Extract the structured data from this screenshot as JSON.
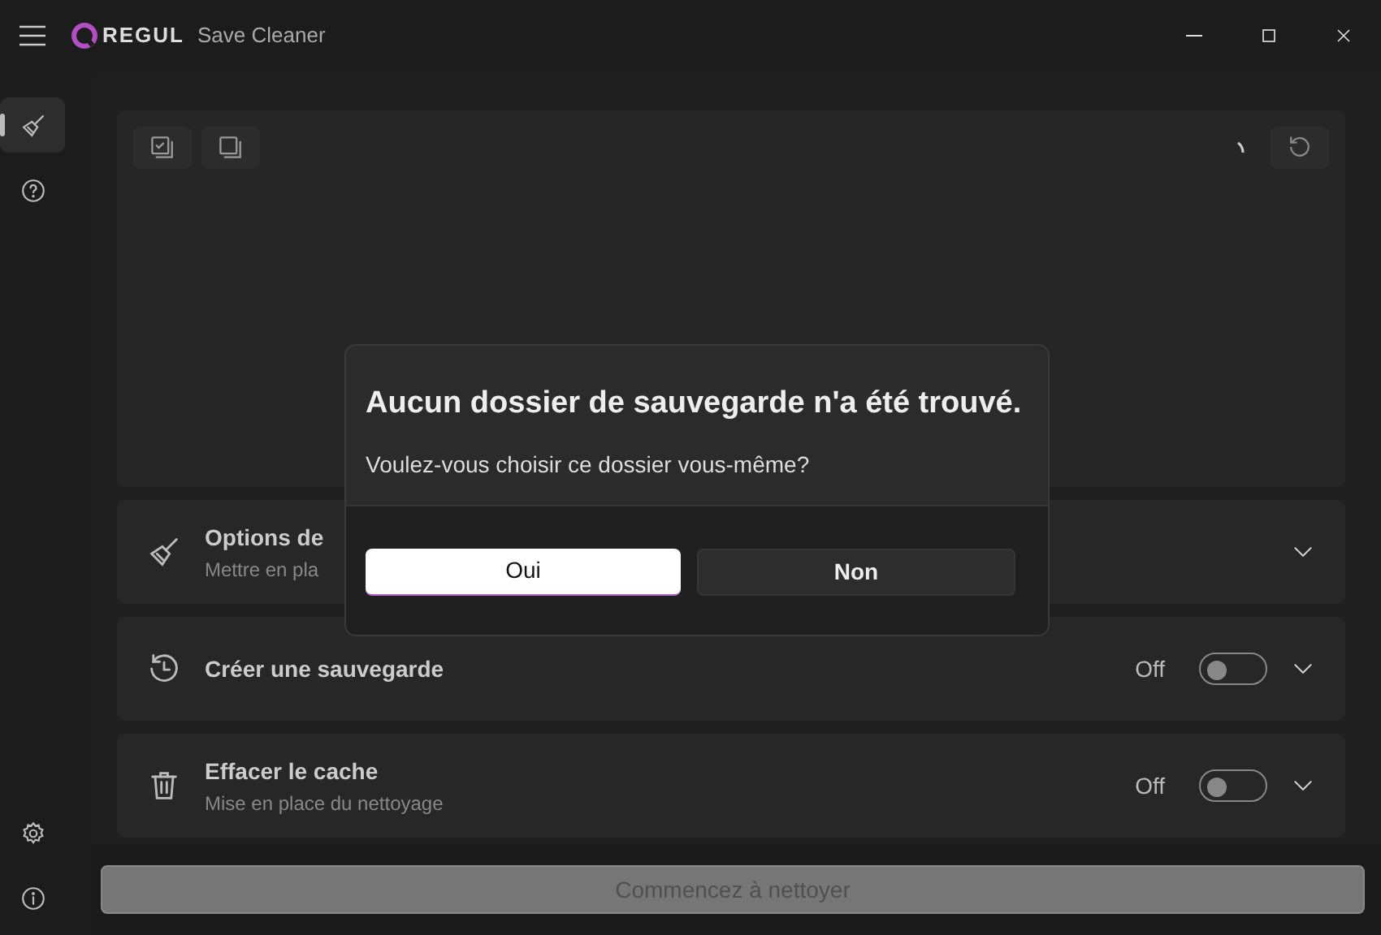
{
  "window": {
    "logo": "REGUL",
    "title": "Save Cleaner"
  },
  "sidebar": {
    "items": [
      {
        "kind": "broom",
        "selected": true
      },
      {
        "kind": "help",
        "selected": false
      }
    ],
    "footer_items": [
      {
        "kind": "settings",
        "selected": false
      },
      {
        "kind": "info",
        "selected": false
      }
    ]
  },
  "panel": {
    "toolbar": [
      {
        "kind": "select-all"
      },
      {
        "kind": "select-none"
      }
    ],
    "loading": true
  },
  "cards": [
    {
      "kind": "broom",
      "title": "Options de",
      "subtitle": "Mettre en pla"
    },
    {
      "kind": "history",
      "title": "Créer une sauvegarde",
      "toggle_label": "Off",
      "on": false
    },
    {
      "kind": "trash",
      "title": "Effacer le cache",
      "subtitle": "Mise en place du nettoyage",
      "toggle_label": "Off",
      "on": false
    }
  ],
  "action_button": {
    "label": "Commencez à nettoyer",
    "disabled": true
  },
  "dialog": {
    "title": "Aucun dossier de sauvegarde n'a été trouvé.",
    "message": "Voulez-vous choisir ce dossier vous-même?",
    "buttons": [
      {
        "label": "Oui",
        "primary": true
      },
      {
        "label": "Non",
        "primary": false
      }
    ]
  }
}
